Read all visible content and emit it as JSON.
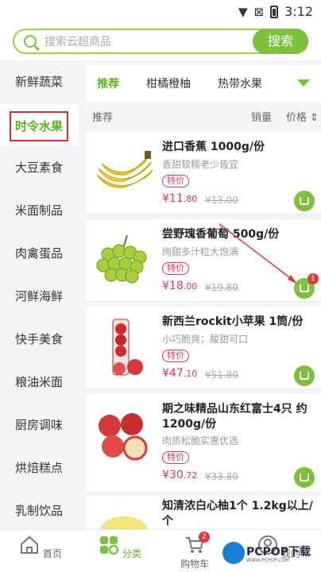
{
  "status": {
    "time": "3:12"
  },
  "search": {
    "placeholder": "搜索云超商品",
    "button": "搜索"
  },
  "sidebar": {
    "items": [
      {
        "label": "新鲜蔬菜"
      },
      {
        "label": "时令水果"
      },
      {
        "label": "大豆素食"
      },
      {
        "label": "米面制品"
      },
      {
        "label": "肉禽蛋品"
      },
      {
        "label": "河鲜海鲜"
      },
      {
        "label": "快手美食"
      },
      {
        "label": "粮油米面"
      },
      {
        "label": "厨房调味"
      },
      {
        "label": "烘焙糕点"
      },
      {
        "label": "乳制饮品"
      }
    ],
    "active_index": 1
  },
  "tabs": [
    {
      "label": "推荐"
    },
    {
      "label": "柑橘橙柚"
    },
    {
      "label": "热带水果"
    }
  ],
  "list_header": {
    "recommend": "推荐",
    "sales": "销量",
    "price": "价格"
  },
  "products": [
    {
      "name": "进口香蕉 1000g/份",
      "desc": "香甜软糯老少皆宜",
      "tag": "特价",
      "price_main": "¥11",
      "price_dec": ".80",
      "old_price": "¥13.00",
      "cart_count": ""
    },
    {
      "name": "尝野瑰香葡萄 500g/份",
      "desc": "绚甜多汁粒大饱满",
      "tag": "特价",
      "price_main": "¥18",
      "price_dec": ".00",
      "old_price": "¥19.80",
      "cart_count": "1"
    },
    {
      "name": "新西兰rockit小苹果 1筒/份",
      "desc": "小巧脆爽；酸甜可口",
      "tag": "特价",
      "price_main": "¥47",
      "price_dec": ".10",
      "old_price": "¥51.80",
      "cart_count": ""
    },
    {
      "name": "期之味精品山东红富士4只 约1200g/份",
      "desc": "肉质松脆实惠优选",
      "tag": "特价",
      "price_main": "¥30",
      "price_dec": ".72",
      "old_price": "¥33.80",
      "cart_count": ""
    },
    {
      "name": "知清浓白心柚1个 1.2kg以上/个",
      "desc": "",
      "tag": "",
      "price_main": "",
      "price_dec": "",
      "old_price": "",
      "cart_count": ""
    }
  ],
  "bottom_nav": [
    {
      "label": "首页",
      "icon": "home-icon"
    },
    {
      "label": "分类",
      "icon": "category-icon"
    },
    {
      "label": "购物车",
      "icon": "cart-icon",
      "badge": "2"
    },
    {
      "label": "我的",
      "icon": "user-icon"
    }
  ],
  "watermark": {
    "text": "PCPOP下载",
    "sub": "WWW.PCPOP.COM"
  },
  "colors": {
    "accent": "#7cc13b",
    "price": "#e0345b",
    "highlight_box": "#d32f2f"
  }
}
